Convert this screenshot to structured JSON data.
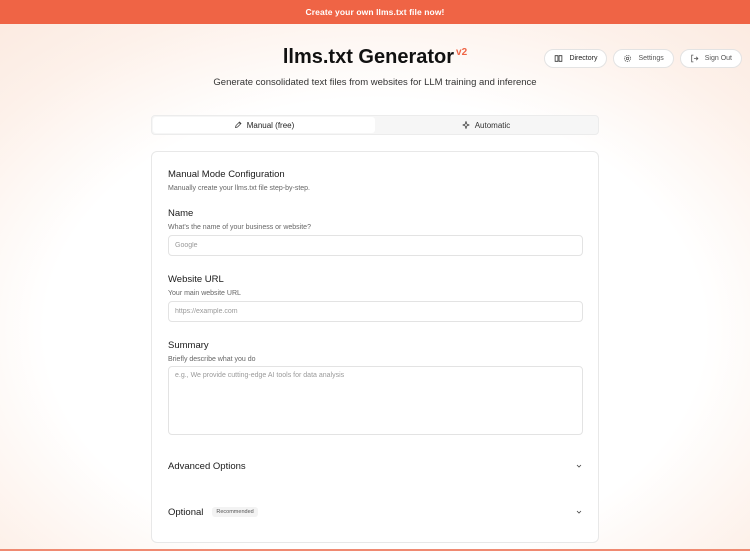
{
  "banner": {
    "text": "Create your own llms.txt file now!"
  },
  "header": {
    "title": "llms.txt Generator",
    "version": "v2",
    "subtitle": "Generate consolidated text files from websites for LLM training and inference",
    "directory_label": "Directory",
    "settings_label": "Settings",
    "signout_label": "Sign Out"
  },
  "tabs": [
    {
      "label": "Manual (free)",
      "icon": "pencil-icon",
      "active": true
    },
    {
      "label": "Automatic",
      "icon": "sparkle-icon",
      "active": false
    }
  ],
  "form": {
    "title": "Manual Mode Configuration",
    "description": "Manually create your llms.txt file step-by-step.",
    "name": {
      "label": "Name",
      "hint": "What's the name of your business or website?",
      "placeholder": "Google",
      "value": ""
    },
    "url": {
      "label": "Website URL",
      "hint": "Your main website URL",
      "placeholder": "https://example.com",
      "value": ""
    },
    "summary": {
      "label": "Summary",
      "hint": "Briefly describe what you do",
      "placeholder": "e.g., We provide cutting-edge AI tools for data analysis",
      "value": ""
    },
    "advanced": {
      "label": "Advanced Options"
    },
    "optional": {
      "label": "Optional",
      "badge": "Recommended"
    }
  },
  "colors": {
    "accent": "#ef6445",
    "border": "#e3e3e3"
  }
}
